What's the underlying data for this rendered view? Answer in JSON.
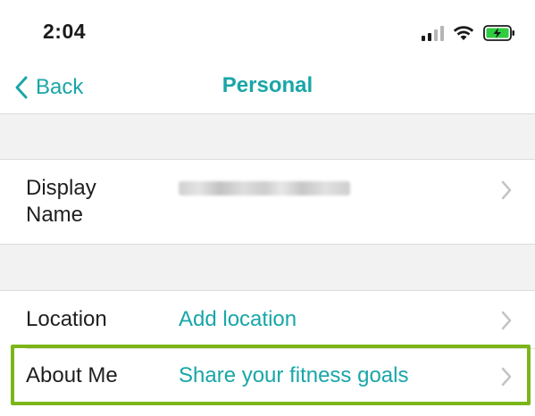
{
  "status_bar": {
    "time": "2:04",
    "icons": [
      "signal-icon",
      "wifi-icon",
      "battery-charging-icon"
    ],
    "battery_color": "#2ecc40"
  },
  "nav": {
    "back_label": "Back",
    "title": "Personal",
    "accent_color": "#19a6a8"
  },
  "rows": {
    "display_name": {
      "label_line1": "Display",
      "label_line2": "Name",
      "value_redacted": true
    },
    "location": {
      "label": "Location",
      "value": "Add location"
    },
    "about_me": {
      "label": "About Me",
      "value": "Share your fitness goals",
      "highlight_color": "#7cb518"
    }
  }
}
